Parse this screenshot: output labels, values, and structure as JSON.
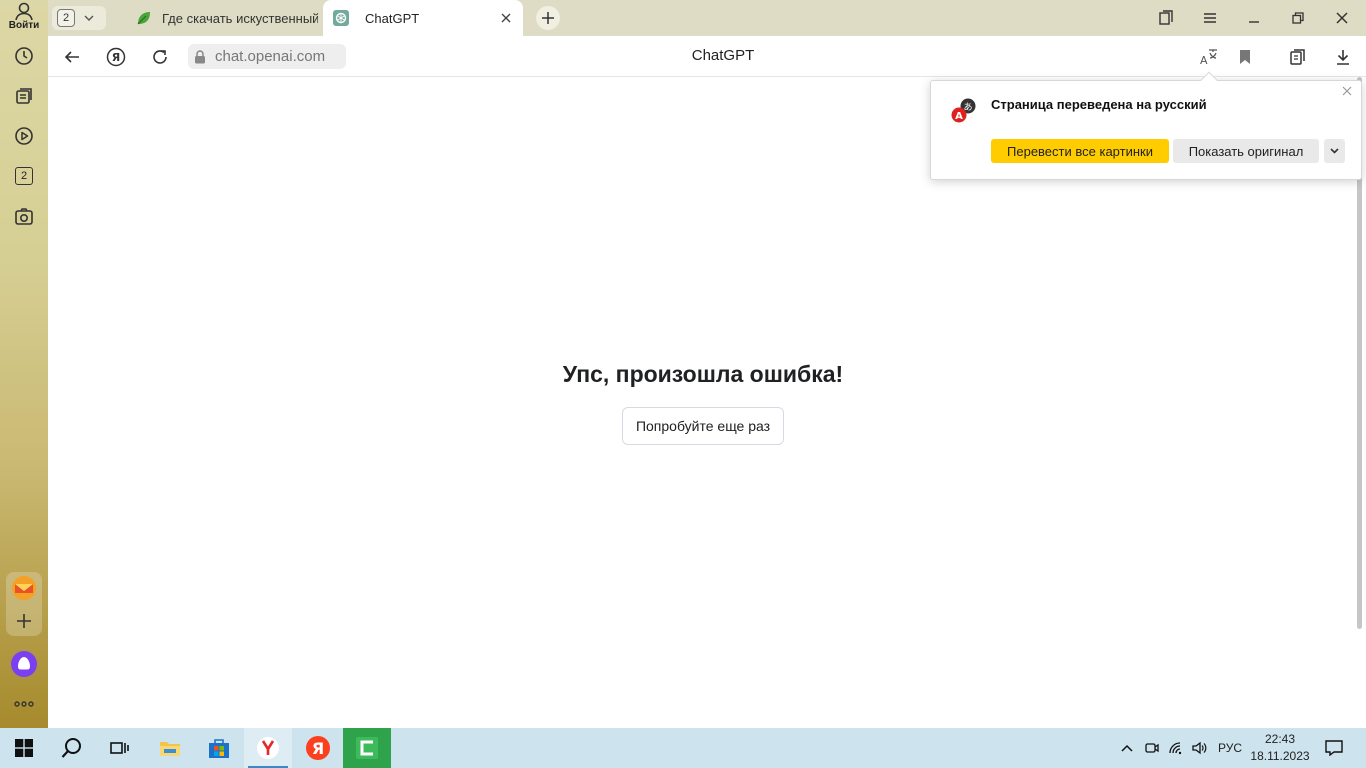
{
  "sidebar": {
    "login_label": "Войти",
    "icons": [
      "avatar-icon",
      "history-icon",
      "collections-icon",
      "video-icon",
      "tabs-counter-icon",
      "screenshot-icon",
      "mail-icon",
      "add-icon",
      "alice-icon",
      "more-icon"
    ],
    "tabs_counter": "2"
  },
  "tabs": {
    "count": "2",
    "items": [
      {
        "title": "Где скачать искуственный интеллект",
        "active": false
      },
      {
        "title": "ChatGPT",
        "active": true
      }
    ]
  },
  "address_bar": {
    "url": "chat.openai.com",
    "page_title": "ChatGPT"
  },
  "page": {
    "error_title": "Упс, произошла ошибка!",
    "retry_label": "Попробуйте еще раз"
  },
  "translate_popup": {
    "title": "Страница переведена на русский",
    "translate_images_label": "Перевести все картинки",
    "show_original_label": "Показать оригинал"
  },
  "taskbar": {
    "language": "РУС",
    "time": "22:43",
    "date": "18.11.2023"
  },
  "colors": {
    "accent_yellow": "#ffcc00",
    "taskbar_bg": "#cde3ee",
    "tabstrip_bg": "#dedcc4"
  }
}
